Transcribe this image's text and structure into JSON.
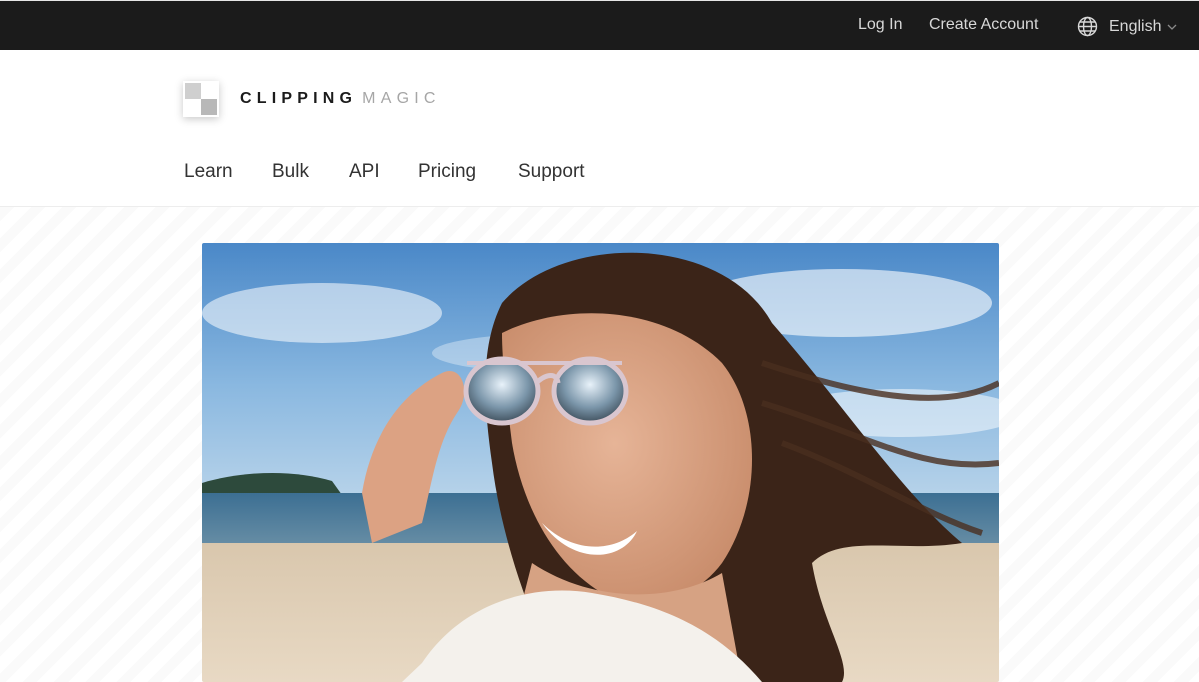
{
  "topbar": {
    "login_label": "Log In",
    "create_account_label": "Create Account",
    "language_label": "English",
    "language_icon": "globe-icon",
    "dropdown_icon": "chevron-down-icon"
  },
  "brand": {
    "name_bold": "CLIPPING",
    "name_light": "MAGIC",
    "logo_icon": "checkerboard-logo-icon"
  },
  "nav": {
    "items": [
      {
        "label": "Learn"
      },
      {
        "label": "Bulk"
      },
      {
        "label": "API"
      },
      {
        "label": "Pricing"
      },
      {
        "label": "Support"
      }
    ]
  },
  "hero": {
    "image": "photo of smiling woman holding sunglasses on a beach"
  },
  "colors": {
    "topbar_bg": "#1b1b1b",
    "topbar_text": "#d8d8d8",
    "nav_text": "#333333",
    "logo_light": "#a6a6a6"
  }
}
